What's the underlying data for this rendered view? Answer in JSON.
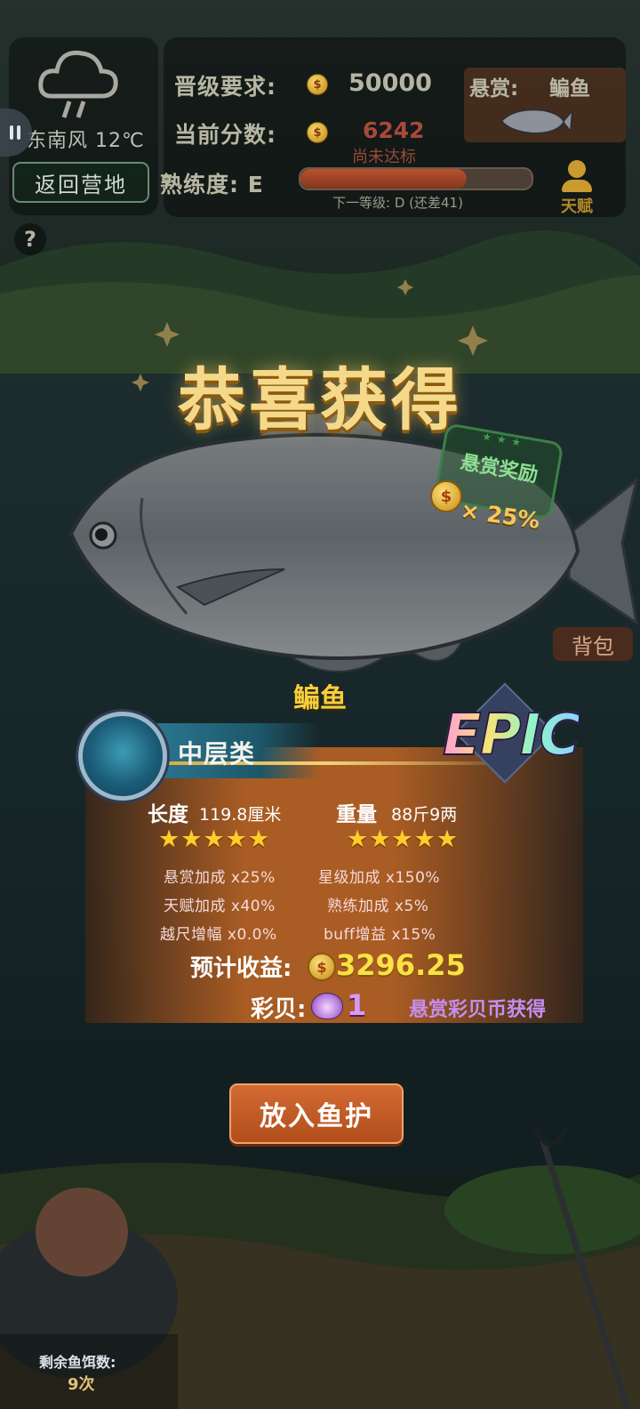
{
  "weather": {
    "wind": "东南风 12℃",
    "back_label": "返回营地",
    "help_label": "?"
  },
  "info": {
    "promotion_label": "晋级要求:",
    "promotion_value": "50000",
    "current_label": "当前分数:",
    "current_value": "6242",
    "current_status": "尚未达标",
    "bounty_label": "悬赏:",
    "bounty_fish": "鳊鱼",
    "proficiency_label": "熟练度: E",
    "proficiency_progress": 0.72,
    "next_level": "下一等级: D (还差41)",
    "talent_label": "天赋",
    "coin_glyph": "$"
  },
  "catch": {
    "congrats": "恭喜获得",
    "stamp_text": "悬赏奖励",
    "stamp_bonus": "× 25%",
    "fish_name": "鳊鱼",
    "bag_label": "背包"
  },
  "result": {
    "category": "中层类",
    "rarity": "EPIC",
    "length_label": "长度",
    "length_value": "119.8厘米",
    "weight_label": "重量",
    "weight_value": "88斤9两",
    "length_stars": "★★★★★",
    "weight_stars": "★★★★★",
    "bonuses": [
      "悬赏加成 x25%",
      "星级加成 x150%",
      "天赋加成 x40%",
      "熟练加成 x5%",
      "越尺增幅 x0.0%",
      "buff增益 x15%"
    ],
    "income_label": "预计收益:",
    "income_value": "3296.25",
    "shell_label": "彩贝:",
    "shell_value": "1",
    "shell_note": "悬赏彩贝币获得"
  },
  "actions": {
    "put_label": "放入鱼护"
  },
  "bait": {
    "label": "剩余鱼饵数:",
    "count": "9次"
  },
  "colors": {
    "accent_gold": "#fde045",
    "button_orange": "#c45a24",
    "shell_purple": "#d79af2"
  }
}
